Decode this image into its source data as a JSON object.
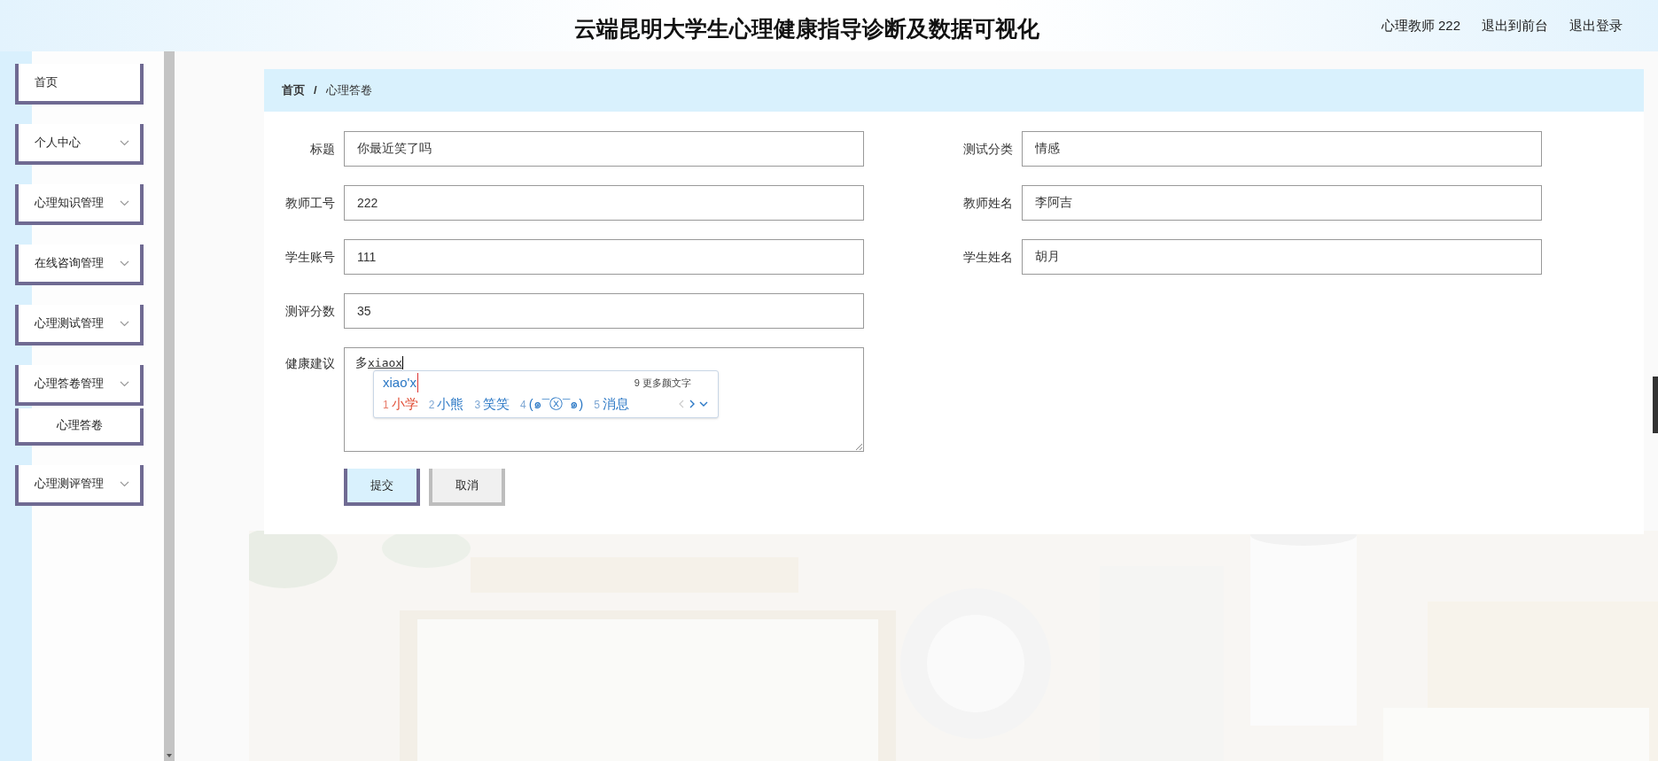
{
  "header": {
    "title": "云端昆明大学生心理健康指导诊断及数据可视化",
    "user": "心理教师 222",
    "links": [
      "退出到前台",
      "退出登录"
    ]
  },
  "sidebar": {
    "items": [
      {
        "label": "首页",
        "kind": "link"
      },
      {
        "label": "个人中心",
        "kind": "group"
      },
      {
        "label": "心理知识管理",
        "kind": "group"
      },
      {
        "label": "在线咨询管理",
        "kind": "group"
      },
      {
        "label": "心理测试管理",
        "kind": "group"
      },
      {
        "label": "心理答卷管理",
        "kind": "group",
        "children": [
          {
            "label": "心理答卷"
          }
        ]
      },
      {
        "label": "心理测评管理",
        "kind": "group"
      }
    ]
  },
  "breadcrumb": [
    "首页",
    "心理答卷"
  ],
  "breadcrumb_separator": "/",
  "form": {
    "left": [
      {
        "label": "标题",
        "value": "你最近笑了吗"
      },
      {
        "label": "教师工号",
        "value": "222"
      },
      {
        "label": "学生账号",
        "value": "111"
      },
      {
        "label": "测评分数",
        "value": "35"
      }
    ],
    "right": [
      {
        "label": "测试分类",
        "value": "情感"
      },
      {
        "label": "教师姓名",
        "value": "李阿吉"
      },
      {
        "label": "学生姓名",
        "value": "胡月"
      }
    ],
    "advice": {
      "label": "健康建议",
      "value": "多",
      "composition": "xiaox"
    },
    "buttons": [
      {
        "label": "提交",
        "kind": "primary"
      },
      {
        "label": "取消",
        "kind": "secondary"
      }
    ]
  },
  "ime": {
    "pinyin": "xiao'x",
    "more": "9 更多颜文字",
    "candidates": [
      {
        "index": "1",
        "text": "小学",
        "selected": true
      },
      {
        "index": "2",
        "text": "小熊",
        "selected": false
      },
      {
        "index": "3",
        "text": "笑笑",
        "selected": false
      },
      {
        "index": "4",
        "text": "(๑¯ⓧ¯๑)",
        "selected": false
      },
      {
        "index": "5",
        "text": "消息",
        "selected": false
      }
    ]
  }
}
